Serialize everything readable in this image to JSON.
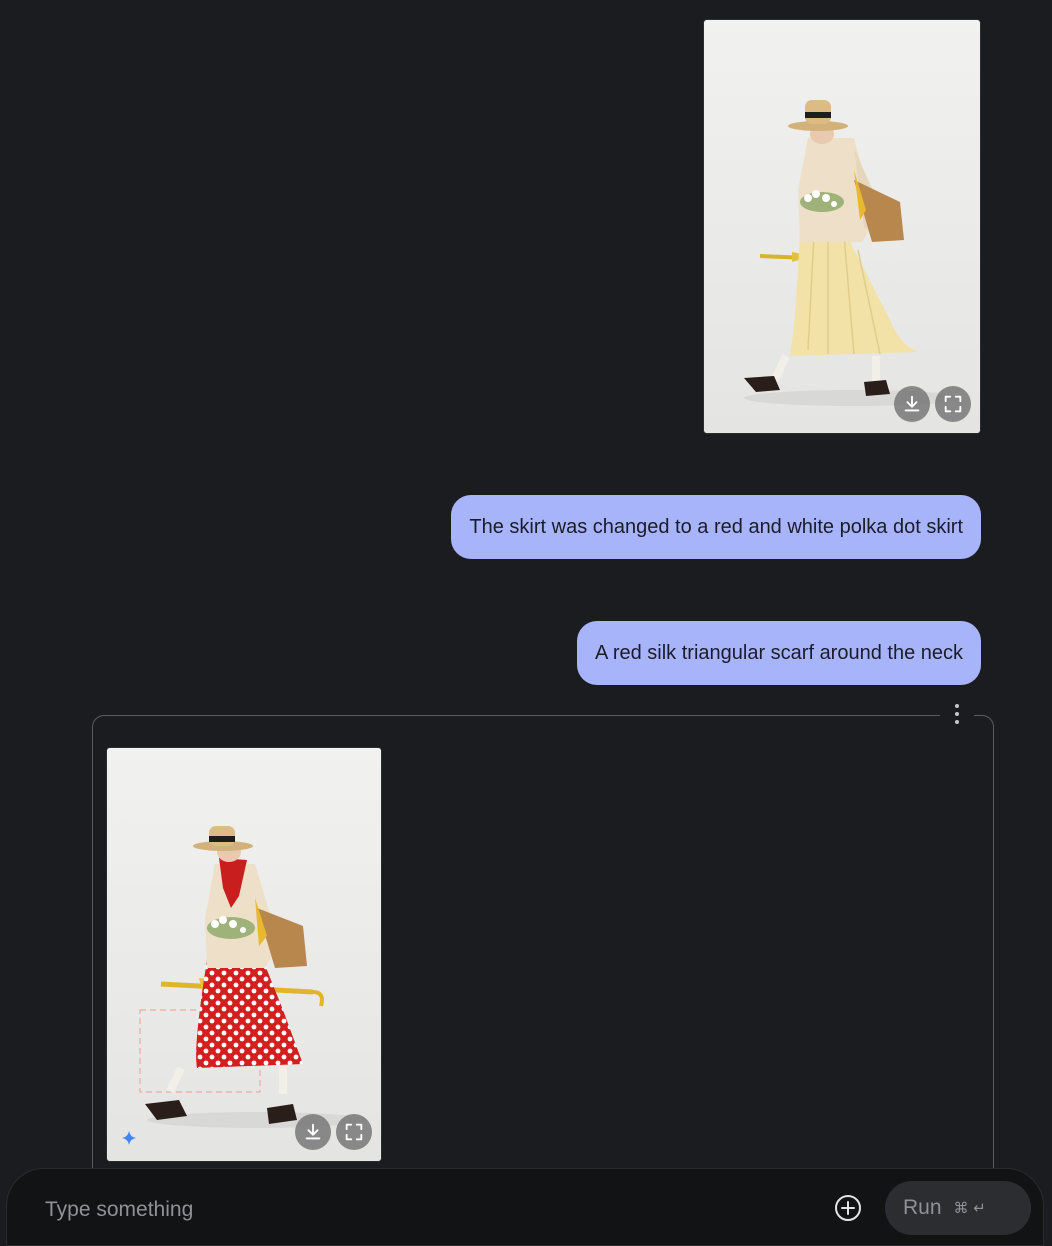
{
  "messages": [
    {
      "role": "user",
      "type": "image",
      "subject": "woman in straw hat, cream jacket, yellow pleated skirt, carrying flowers, bag and umbrella",
      "actions": [
        "download-icon",
        "fullscreen-icon"
      ]
    },
    {
      "role": "user",
      "type": "text",
      "text": "The skirt was changed to a red and white polka dot skirt"
    },
    {
      "role": "user",
      "type": "text",
      "text": "A red silk triangular scarf around the neck"
    },
    {
      "role": "model",
      "type": "image",
      "subject": "same woman with red scarf and red polka dot skirt",
      "actions": [
        "download-icon",
        "fullscreen-icon"
      ],
      "badge": "sparkle-icon"
    }
  ],
  "input": {
    "placeholder": "Type something",
    "value": ""
  },
  "run_button": {
    "label": "Run",
    "shortcut": "⌘ ↵"
  },
  "colors": {
    "background": "#1b1c1f",
    "user_bubble": "#a8b4fa",
    "input_bar": "#121315",
    "run_button": "#2c2d31",
    "sparkle": "#4285f4"
  }
}
